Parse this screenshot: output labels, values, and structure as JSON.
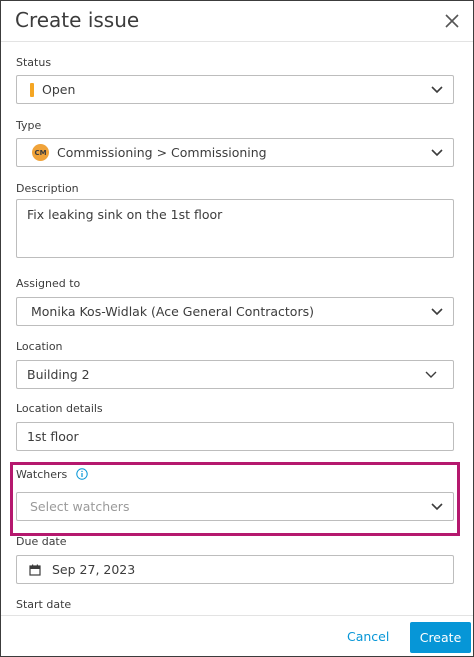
{
  "dialog": {
    "title": "Create issue"
  },
  "status": {
    "label": "Status",
    "value": "Open",
    "indicator_color": "#f5a623"
  },
  "type": {
    "label": "Type",
    "badge": "CM",
    "value": "Commissioning > Commissioning"
  },
  "description": {
    "label": "Description",
    "value": "Fix leaking sink on the 1st floor"
  },
  "assigned_to": {
    "label": "Assigned to",
    "value": "Monika Kos-Widlak (Ace General Contractors)"
  },
  "location": {
    "label": "Location",
    "value": "Building 2"
  },
  "location_details": {
    "label": "Location details",
    "value": "1st floor"
  },
  "watchers": {
    "label": "Watchers",
    "placeholder": "Select watchers",
    "highlight_color": "#b5186e"
  },
  "due_date": {
    "label": "Due date",
    "value": "Sep 27, 2023"
  },
  "start_date": {
    "label": "Start date"
  },
  "footer": {
    "cancel_label": "Cancel",
    "create_label": "Create",
    "accent": "#0696d7"
  }
}
